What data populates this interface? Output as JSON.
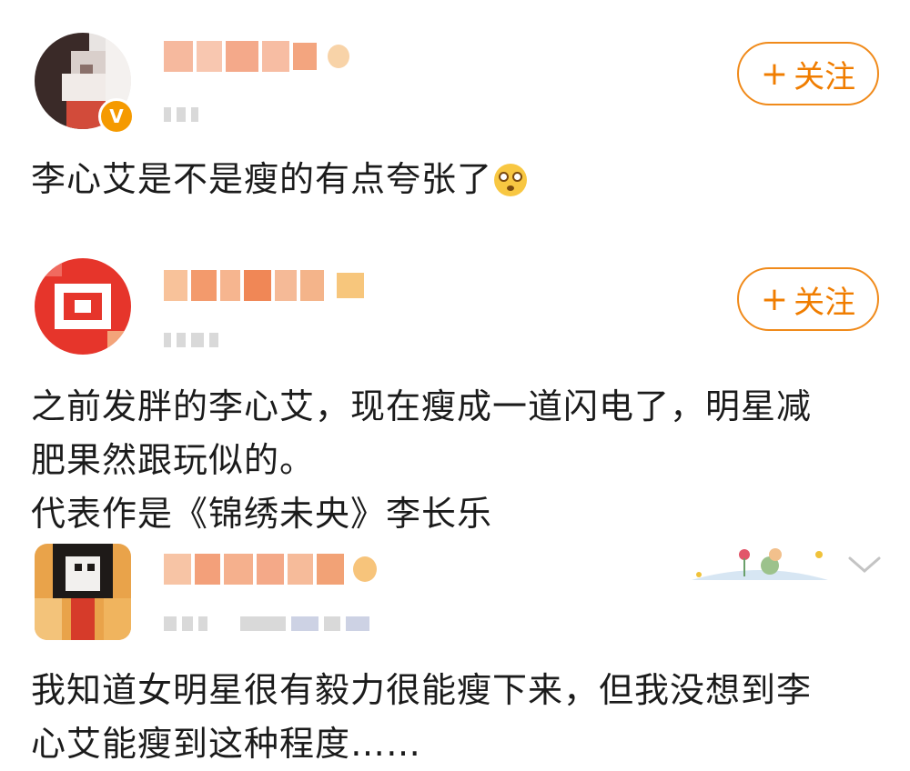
{
  "posts": [
    {
      "follow_label": "关注",
      "text": "李心艾是不是瘦的有点夸张了",
      "emoji": "dizzy-face-emoji"
    },
    {
      "follow_label": "关注",
      "text_lines": [
        "之前发胖的李心艾，现在瘦成一道闪电了，明星减",
        "肥果然跟玩似的。",
        "代表作是《锦绣未央》李长乐"
      ]
    },
    {
      "text_lines": [
        "我知道女明星很有毅力很能瘦下来，但我没想到李",
        "心艾能瘦到这种程度……"
      ]
    }
  ],
  "follow_plus": "+",
  "verified_badge": "V",
  "icons": [
    "verified-badge-icon",
    "chevron-down-icon",
    "sticker-decoration"
  ],
  "colors": {
    "accent": "#f07d00",
    "text": "#1b1b1b",
    "meta": "#c9c9c9"
  }
}
